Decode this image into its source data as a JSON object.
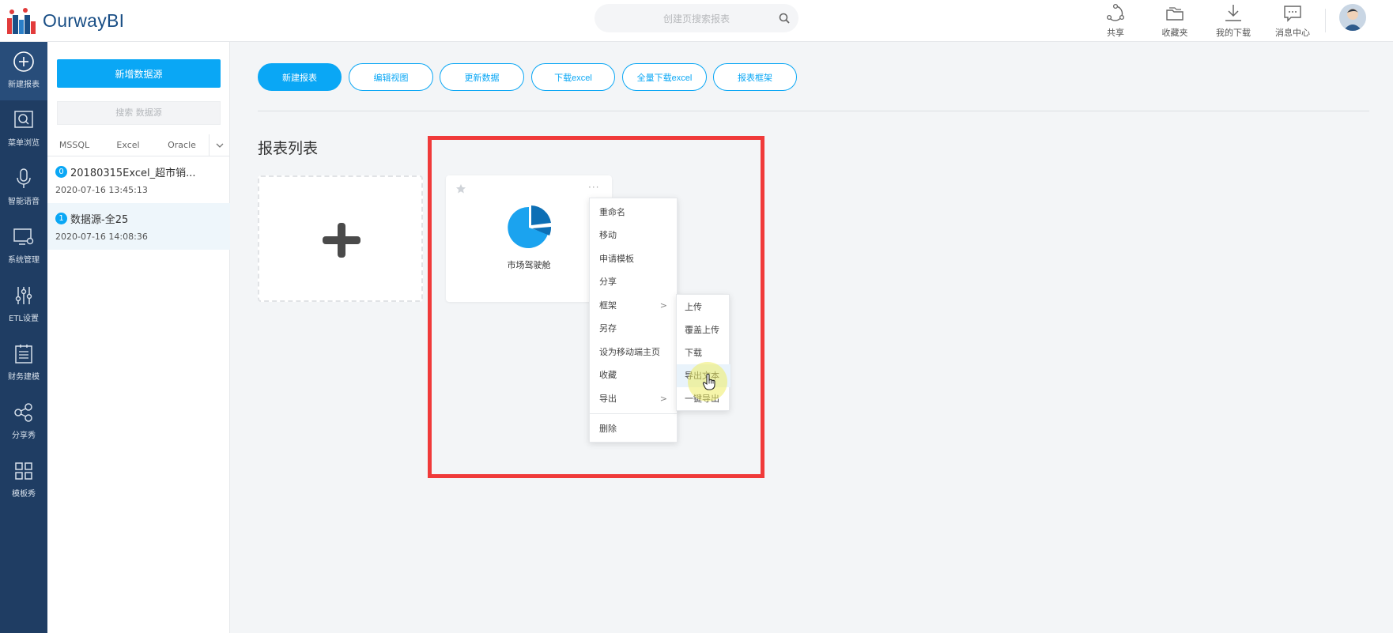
{
  "app": {
    "name": "OurwayBI"
  },
  "header": {
    "search_placeholder": "创建页搜索报表",
    "actions": [
      {
        "label": "共享",
        "icon": "share-icon"
      },
      {
        "label": "收藏夹",
        "icon": "folder-icon"
      },
      {
        "label": "我的下载",
        "icon": "download-icon"
      },
      {
        "label": "消息中心",
        "icon": "message-icon"
      }
    ]
  },
  "nav": {
    "items": [
      {
        "label": "新建报表",
        "icon": "plus-circle-icon",
        "active": true
      },
      {
        "label": "菜单浏览",
        "icon": "browse-icon"
      },
      {
        "label": "智能语音",
        "icon": "microphone-icon"
      },
      {
        "label": "系统管理",
        "icon": "monitor-settings-icon"
      },
      {
        "label": "ETL设置",
        "icon": "sliders-icon"
      },
      {
        "label": "财务建模",
        "icon": "clipboard-list-icon"
      },
      {
        "label": "分享秀",
        "icon": "share-nodes-icon"
      },
      {
        "label": "模板秀",
        "icon": "grid-icon"
      }
    ]
  },
  "datasource": {
    "add_label": "新增数据源",
    "search_placeholder": "搜索 数据源",
    "tabs": [
      "MSSQL",
      "Excel",
      "Oracle"
    ],
    "items": [
      {
        "badge": "0",
        "name": "20180315Excel_超市销...",
        "time": "2020-07-16 13:45:13"
      },
      {
        "badge": "1",
        "name": "数据源-全25",
        "time": "2020-07-16 14:08:36"
      }
    ]
  },
  "toolbar": {
    "buttons": [
      "新建报表",
      "编辑视图",
      "更新数据",
      "下载excel",
      "全量下载excel",
      "报表框架"
    ]
  },
  "section": {
    "title": "报表列表"
  },
  "report": {
    "name": "市场驾驶舱"
  },
  "context_menu": {
    "items": [
      "重命名",
      "移动",
      "申请模板",
      "分享",
      "框架",
      "另存",
      "设为移动端主页",
      "收藏",
      "导出",
      "删除"
    ],
    "submenu": [
      "上传",
      "覆盖上传",
      "下载",
      "导出文本",
      "一键导出"
    ]
  },
  "colors": {
    "accent": "#0aa7f5",
    "nav_bg": "#1f3d63",
    "highlight": "#f03a3a"
  }
}
